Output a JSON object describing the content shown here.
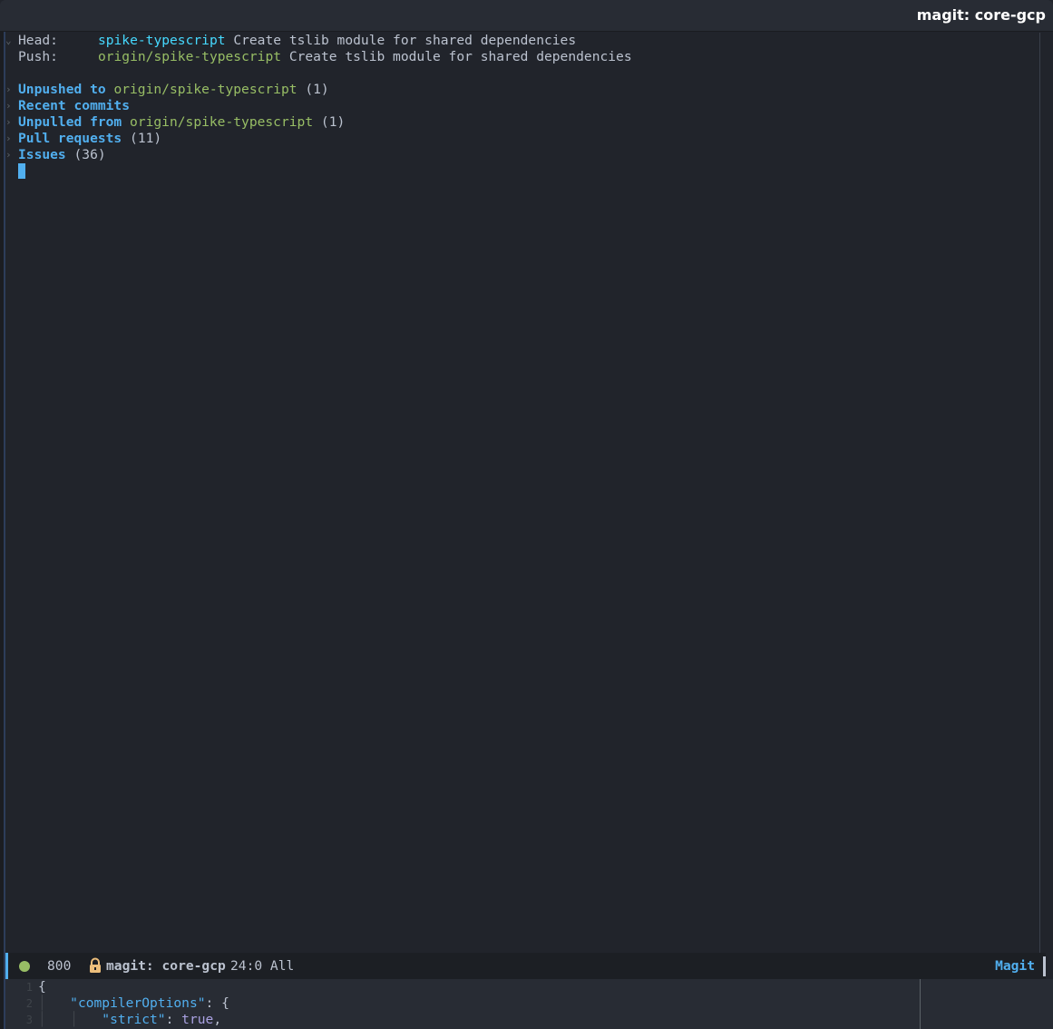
{
  "window": {
    "title": "magit: core-gcp"
  },
  "status": {
    "head": {
      "label": "Head:",
      "branch": "spike-typescript",
      "message": "Create tslib module for shared dependencies"
    },
    "push": {
      "label": "Push:",
      "branch": "origin/spike-typescript",
      "message": "Create tslib module for shared dependencies"
    },
    "sections": [
      {
        "heading": "Unpushed to",
        "branch": "origin/spike-typescript",
        "count": "(1)"
      },
      {
        "heading": "Recent commits",
        "branch": "",
        "count": ""
      },
      {
        "heading": "Unpulled from",
        "branch": "origin/spike-typescript",
        "count": "(1)"
      },
      {
        "heading": "Pull requests",
        "branch": "",
        "count": "(11)"
      },
      {
        "heading": "Issues",
        "branch": "",
        "count": "(36)"
      }
    ]
  },
  "modeline": {
    "line_count": "800",
    "buffer_name": "magit: core-gcp",
    "position": "24:0 All",
    "major_mode": "Magit",
    "status_color": "#98be65"
  },
  "code": {
    "lines": [
      {
        "num": "1",
        "text": "{"
      },
      {
        "num": "2",
        "key": "\"compilerOptions\"",
        "rest": ": {"
      },
      {
        "num": "3",
        "key": "\"strict\"",
        "sep": ": ",
        "value": "true",
        "rest": ","
      }
    ]
  },
  "icons": {
    "fold_open": "chevron-down-icon",
    "fold_closed": "chevron-right-icon",
    "lock": "lock-icon"
  }
}
